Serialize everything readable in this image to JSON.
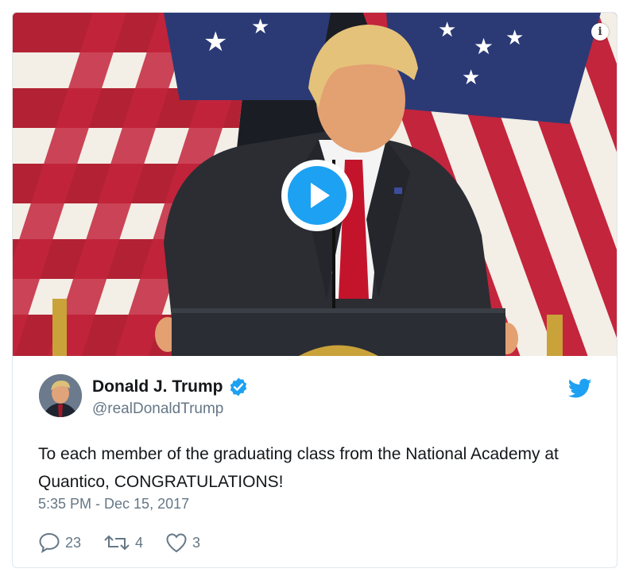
{
  "tweet": {
    "author_name": "Donald J. Trump",
    "handle": "@realDonaldTrump",
    "text": "To each member of the graduating class from the National Academy at Quantico, CONGRATULATIONS!",
    "timestamp": "5:35 PM - Dec 15, 2017",
    "verified": true
  },
  "actions": {
    "replies": "23",
    "retweets": "4",
    "likes": "3"
  },
  "media": {
    "type": "video",
    "info_icon": "info-icon",
    "play_icon": "play-icon"
  },
  "colors": {
    "accent": "#1da1f2",
    "text": "#14171a",
    "secondary": "#657786",
    "border": "#e1e8ed"
  }
}
